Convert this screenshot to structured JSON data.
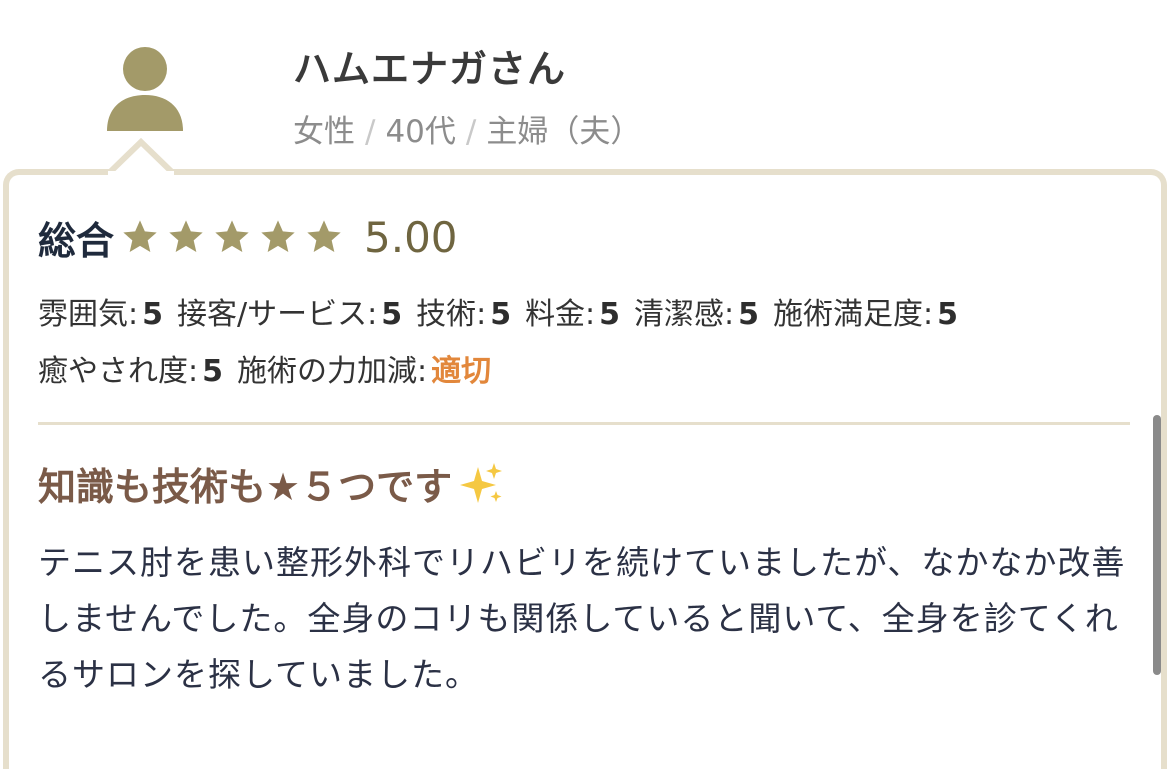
{
  "reviewer": {
    "name": "ハムエナガさん",
    "gender": "女性",
    "age": "40代",
    "occupation": "主婦（夫）",
    "separator": "/"
  },
  "overall": {
    "label": "総合",
    "score": "5.00",
    "stars": 5,
    "star_color": "#a39a69"
  },
  "ratings": [
    {
      "label": "雰囲気:",
      "value": "5"
    },
    {
      "label": "接客/サービス:",
      "value": "5"
    },
    {
      "label": "技術:",
      "value": "5"
    },
    {
      "label": "料金:",
      "value": "5"
    },
    {
      "label": "清潔感:",
      "value": "5"
    },
    {
      "label": "施術満足度:",
      "value": "5"
    },
    {
      "label": "癒やされ度:",
      "value": "5"
    },
    {
      "label": "施術の力加減:",
      "value": "適切"
    }
  ],
  "review": {
    "title": "知識も技術も★５つです",
    "title_emoji": "sparkles-icon",
    "body": "テニス肘を患い整形外科でリハビリを続けていましたが、なかなか改善しませんでした。全身のコリも関係していると聞いて、全身を診てくれるサロンを探していました。"
  },
  "colors": {
    "accent_gold": "#a39a69",
    "highlight_orange": "#e2873b",
    "title_brown": "#7a5a48",
    "border_beige": "#e6dfcc"
  }
}
